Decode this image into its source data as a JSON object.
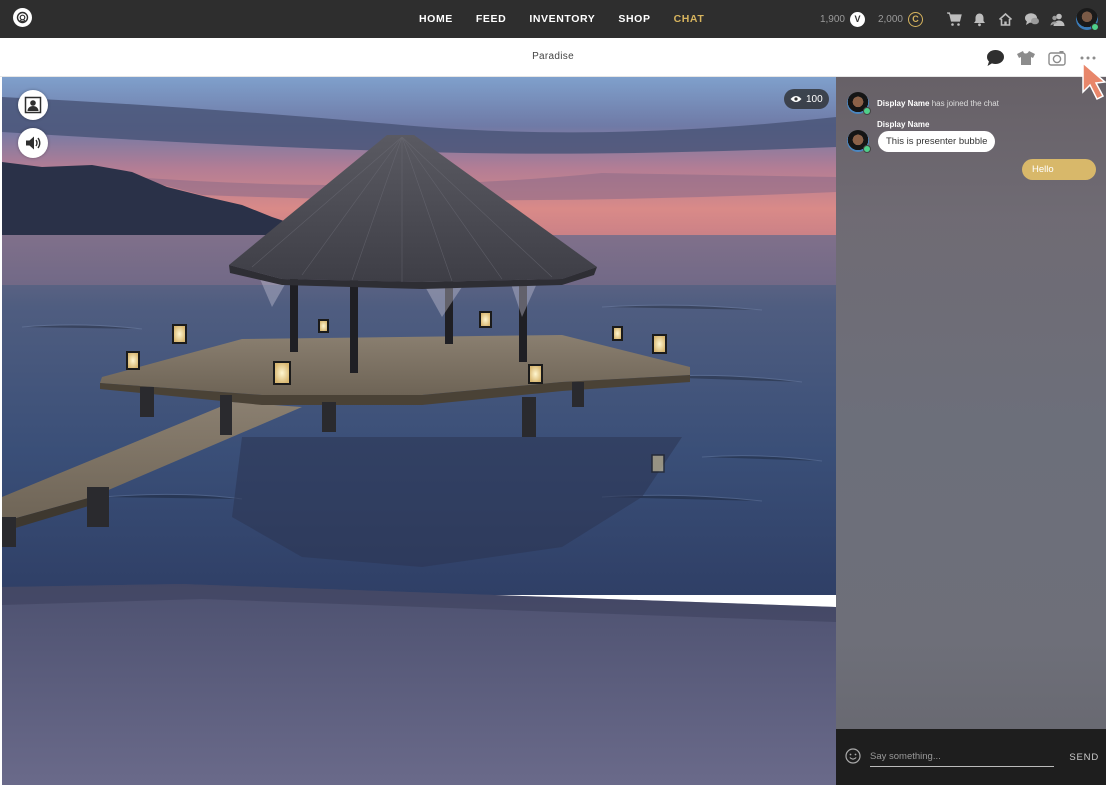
{
  "nav": {
    "links": [
      {
        "label": "HOME",
        "active": false
      },
      {
        "label": "FEED",
        "active": false
      },
      {
        "label": "INVENTORY",
        "active": false
      },
      {
        "label": "SHOP",
        "active": false
      },
      {
        "label": "CHAT",
        "active": true
      }
    ],
    "vcoin_balance": "1,900",
    "vcoin_symbol": "V",
    "credits_balance": "2,000",
    "credits_symbol": "C",
    "accent_color": "#d7b45e",
    "icons": [
      "cart-icon",
      "bell-icon",
      "home-icon",
      "messages-icon",
      "friends-icon",
      "profile-avatar"
    ]
  },
  "room": {
    "title": "Paradise",
    "viewer_count": "100",
    "icons": [
      "chat-bubble-icon",
      "outfit-icon",
      "camera-icon",
      "more-icon"
    ]
  },
  "chat": {
    "system_message": {
      "name": "Display Name",
      "text": "has joined the chat"
    },
    "presenter_message": {
      "name": "Display Name",
      "text": "This is  presenter bubble"
    },
    "own_message": {
      "text": "Hello"
    },
    "input_placeholder": "Say something...",
    "send_label": "SEND"
  }
}
